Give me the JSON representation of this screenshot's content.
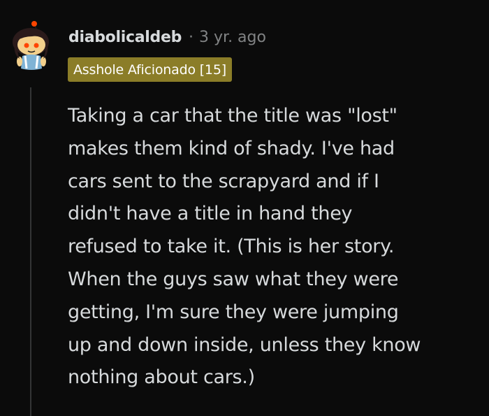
{
  "comment": {
    "username": "diabolicaldeb",
    "separator": "·",
    "time": "3 yr. ago",
    "flair": "Asshole Aficionado [15]",
    "body_lines": [
      "Taking a car that the title was \"lost\"",
      "makes them kind of shady. I've had",
      "cars sent to the scrapyard and if I",
      "didn't have a title in hand they",
      "refused to take it. (This is her story.",
      "When the guys saw what they were",
      "getting, I'm sure they were jumping",
      "up and down inside, unless they know",
      "nothing about cars.)"
    ]
  },
  "colors": {
    "background": "#0b0b0b",
    "text": "#d7dadc",
    "meta": "#818384",
    "flair_bg": "#8b7d28",
    "avatar_accent": "#ff4500"
  },
  "icons": {
    "avatar": "snoo-avatar-icon"
  }
}
